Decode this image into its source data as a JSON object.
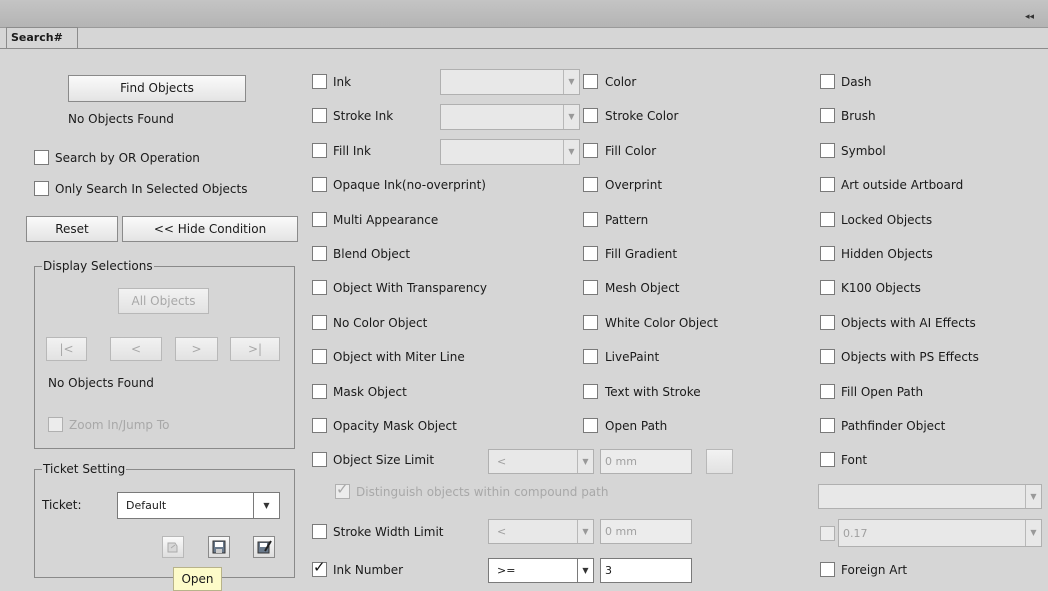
{
  "panel": {
    "tab_label": "Search#",
    "collapse_glyph": "◂◂"
  },
  "left": {
    "find_button": "Find Objects",
    "status_text": "No Objects Found",
    "search_or_label": "Search by OR Operation",
    "only_selected_label": "Only Search In Selected Objects",
    "reset_button": "Reset",
    "hide_condition_button": "<< Hide Condition"
  },
  "display": {
    "legend": "Display Selections",
    "all_objects_button": "All Objects",
    "nav": [
      "|<",
      "<",
      ">",
      ">|"
    ],
    "status_text": "No Objects Found",
    "zoom_label": "Zoom In/Jump To"
  },
  "ticket": {
    "legend": "Ticket Setting",
    "label": "Ticket:",
    "value": "Default",
    "icons": [
      "open-icon",
      "save-icon",
      "save-as-icon"
    ],
    "tooltip": "Open"
  },
  "conditions": {
    "col1": [
      {
        "label": "Ink",
        "checked": false
      },
      {
        "label": "Stroke Ink",
        "checked": false
      },
      {
        "label": "Fill Ink",
        "checked": false
      },
      {
        "label": "Opaque Ink(no-overprint)",
        "checked": false
      },
      {
        "label": "Multi Appearance",
        "checked": false
      },
      {
        "label": "Blend Object",
        "checked": false
      },
      {
        "label": "Object With Transparency",
        "checked": false
      },
      {
        "label": "No Color Object",
        "checked": false
      },
      {
        "label": "Object with Miter Line",
        "checked": false
      },
      {
        "label": "Mask Object",
        "checked": false
      },
      {
        "label": "Opacity Mask Object",
        "checked": false
      },
      {
        "label": "Object Size Limit",
        "checked": false
      }
    ],
    "col2": [
      {
        "label": "Color",
        "checked": false
      },
      {
        "label": "Stroke Color",
        "checked": false
      },
      {
        "label": "Fill Color",
        "checked": false
      },
      {
        "label": "Overprint",
        "checked": false
      },
      {
        "label": "Pattern",
        "checked": false
      },
      {
        "label": "Fill Gradient",
        "checked": false
      },
      {
        "label": "Mesh Object",
        "checked": false
      },
      {
        "label": "White Color Object",
        "checked": false
      },
      {
        "label": "LivePaint",
        "checked": false
      },
      {
        "label": "Text with Stroke",
        "checked": false
      },
      {
        "label": "Open Path",
        "checked": false
      }
    ],
    "col3": [
      {
        "label": "Dash",
        "checked": false
      },
      {
        "label": "Brush",
        "checked": false
      },
      {
        "label": "Symbol",
        "checked": false
      },
      {
        "label": "Art outside Artboard",
        "checked": false
      },
      {
        "label": "Locked Objects",
        "checked": false
      },
      {
        "label": "Hidden Objects",
        "checked": false
      },
      {
        "label": "K100 Objects",
        "checked": false
      },
      {
        "label": "Objects with AI Effects",
        "checked": false
      },
      {
        "label": "Objects with PS Effects",
        "checked": false
      },
      {
        "label": "Fill Open Path",
        "checked": false
      },
      {
        "label": "Pathfinder Object",
        "checked": false
      },
      {
        "label": "Font",
        "checked": false
      }
    ],
    "size_limit_op": "<",
    "size_limit_value": "0 mm",
    "distinguish_label": "Distinguish objects within compound path",
    "stroke_width_label": "Stroke Width Limit",
    "stroke_width_op": "<",
    "stroke_width_value": "0 mm",
    "ink_number_label": "Ink Number",
    "ink_number_checked": true,
    "ink_number_op": ">=",
    "ink_number_value": "3",
    "font_value": "",
    "font_size_value": "0.17",
    "foreign_art_label": "Foreign Art"
  }
}
